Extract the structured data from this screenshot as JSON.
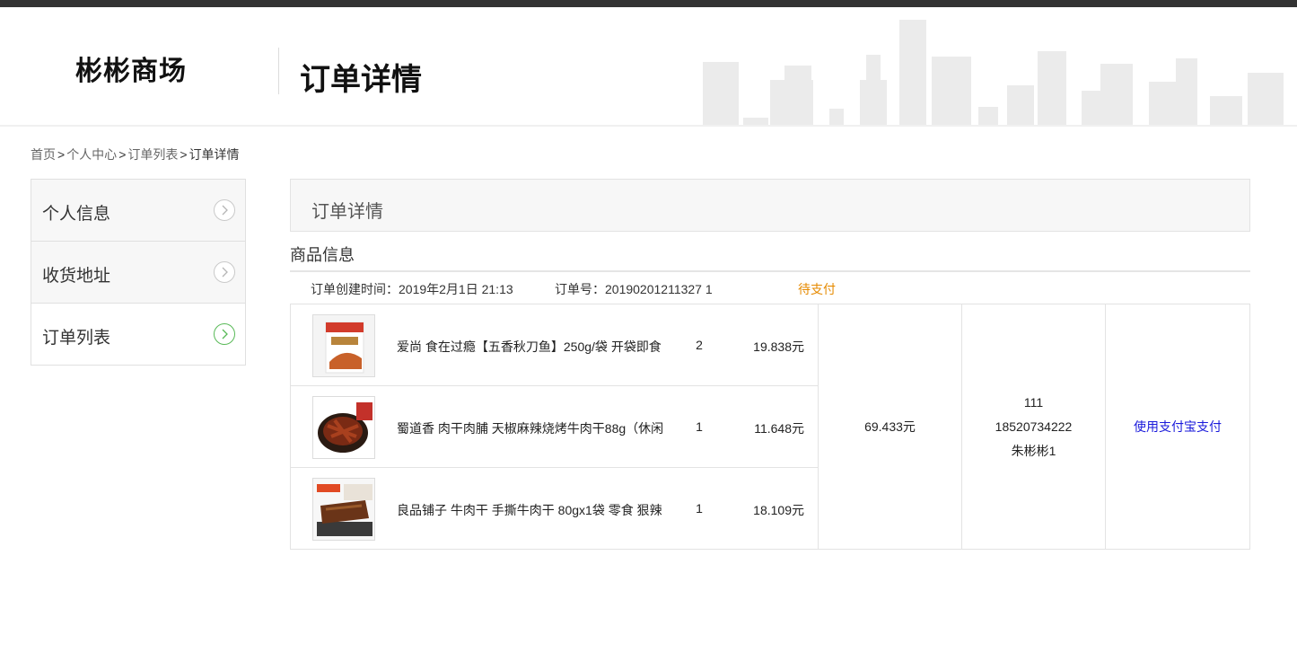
{
  "header": {
    "logo": "彬彬商场",
    "page_heading": "订单详情"
  },
  "breadcrumb": {
    "home": "首页",
    "user_center": "个人中心",
    "order_list": "订单列表",
    "current": "订单详情",
    "separator": ">"
  },
  "sidebar": {
    "items": [
      {
        "label": "个人信息",
        "active": false
      },
      {
        "label": "收货地址",
        "active": false
      },
      {
        "label": "订单列表",
        "active": true
      }
    ]
  },
  "main": {
    "panel_title": "订单详情",
    "section_title": "商品信息",
    "order_meta": {
      "created": "订单创建时间：2019年2月1日 21:13",
      "order_no": "订单号：20190201211327 1",
      "status": "待支付"
    },
    "items": [
      {
        "name": "爱尚 食在过瘾【五香秋刀鱼】250g/袋 开袋即食",
        "qty": "2",
        "price": "19.838元"
      },
      {
        "name": "蜀道香 肉干肉脯 天椒麻辣烧烤牛肉干88g（休闲",
        "qty": "1",
        "price": "11.648元"
      },
      {
        "name": "良品铺子 牛肉干 手撕牛肉干 80gx1袋 零食 狠辣",
        "qty": "1",
        "price": "18.109元"
      }
    ],
    "total": "69.433元",
    "address": {
      "line1": "111",
      "phone": "18520734222",
      "name": "朱彬彬1"
    },
    "pay_action": "使用支付宝支付"
  },
  "colors": {
    "status": "#e68a00",
    "pay_link": "#1a1adb",
    "active_chevron": "#58b957"
  }
}
